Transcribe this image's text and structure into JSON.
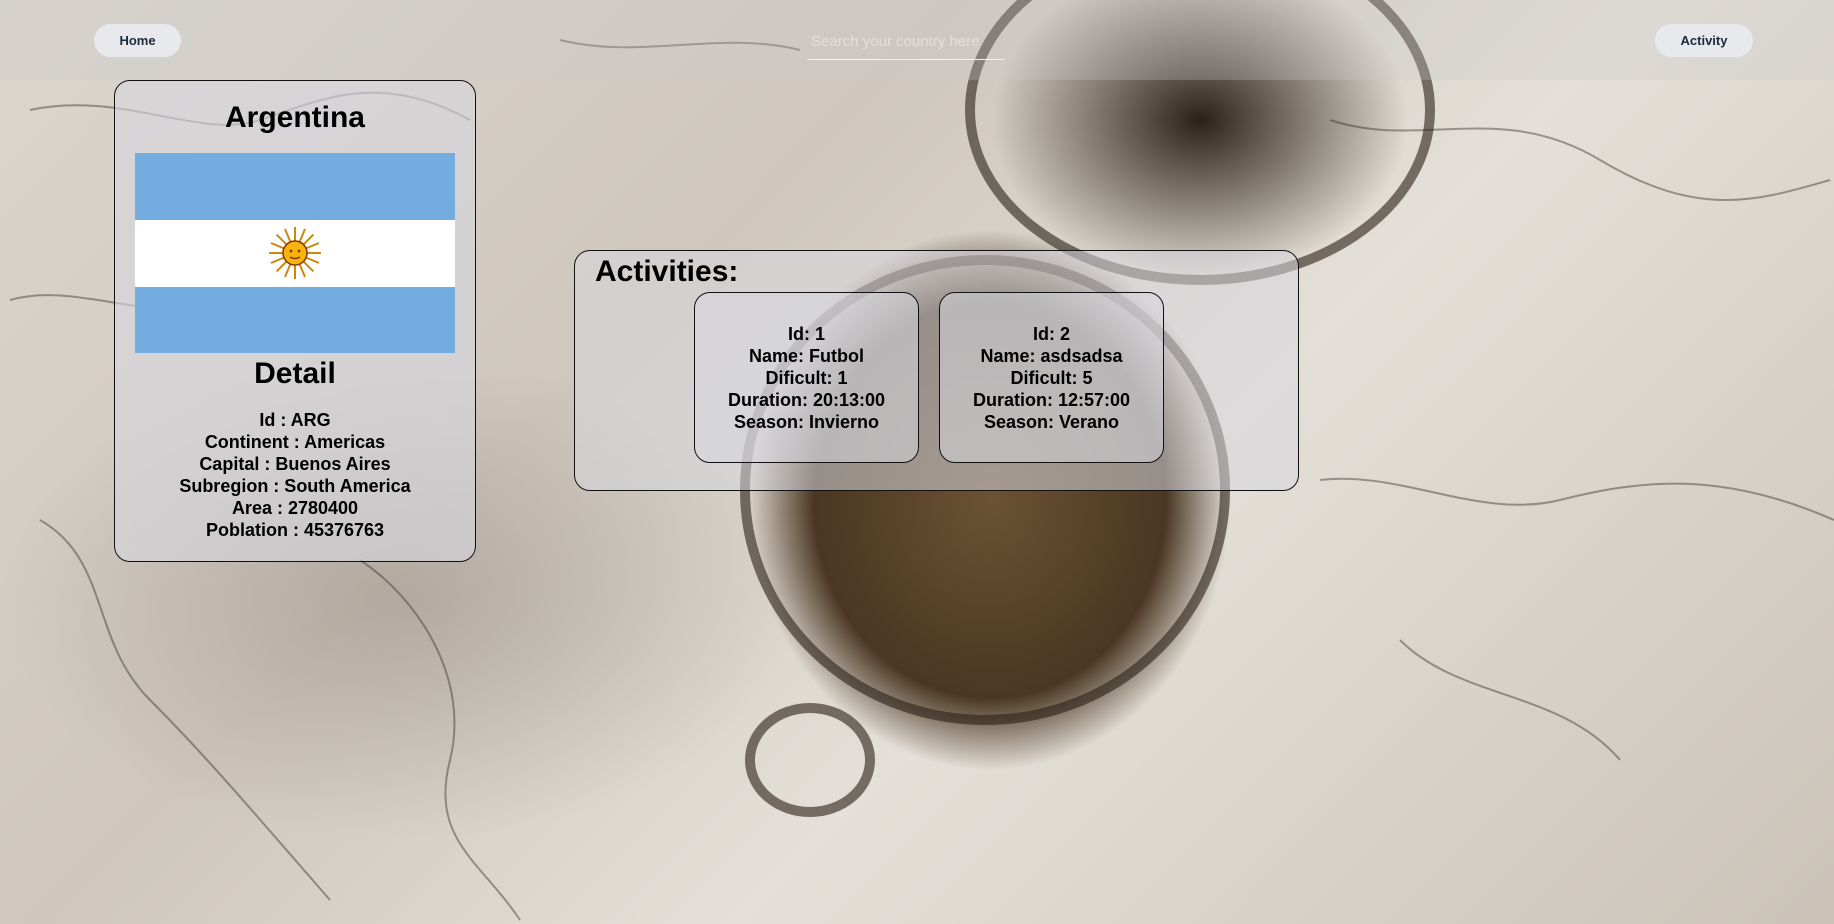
{
  "nav": {
    "home_label": "Home",
    "activity_label": "Activity",
    "search_placeholder": "Search your country here"
  },
  "country": {
    "name": "Argentina",
    "detail_title": "Detail",
    "id": "Id : ARG",
    "continent": "Continent : Americas",
    "capital": "Capital : Buenos Aires",
    "subregion": "Subregion : South America",
    "area": "Area : 2780400",
    "population": "Poblation : 45376763"
  },
  "activities": {
    "title": "Activities:",
    "items": [
      {
        "id": "Id: 1",
        "name": "Name: Futbol",
        "difficulty": "Dificult: 1",
        "duration": "Duration: 20:13:00",
        "season": "Season: Invierno"
      },
      {
        "id": "Id: 2",
        "name": "Name: asdsadsa",
        "difficulty": "Dificult: 5",
        "duration": "Duration: 12:57:00",
        "season": "Season: Verano"
      }
    ]
  },
  "colors": {
    "flag_blue": "#74acdf",
    "flag_white": "#ffffff",
    "flag_sun": "#f6b40e",
    "button_bg": "#e8e9ed"
  }
}
